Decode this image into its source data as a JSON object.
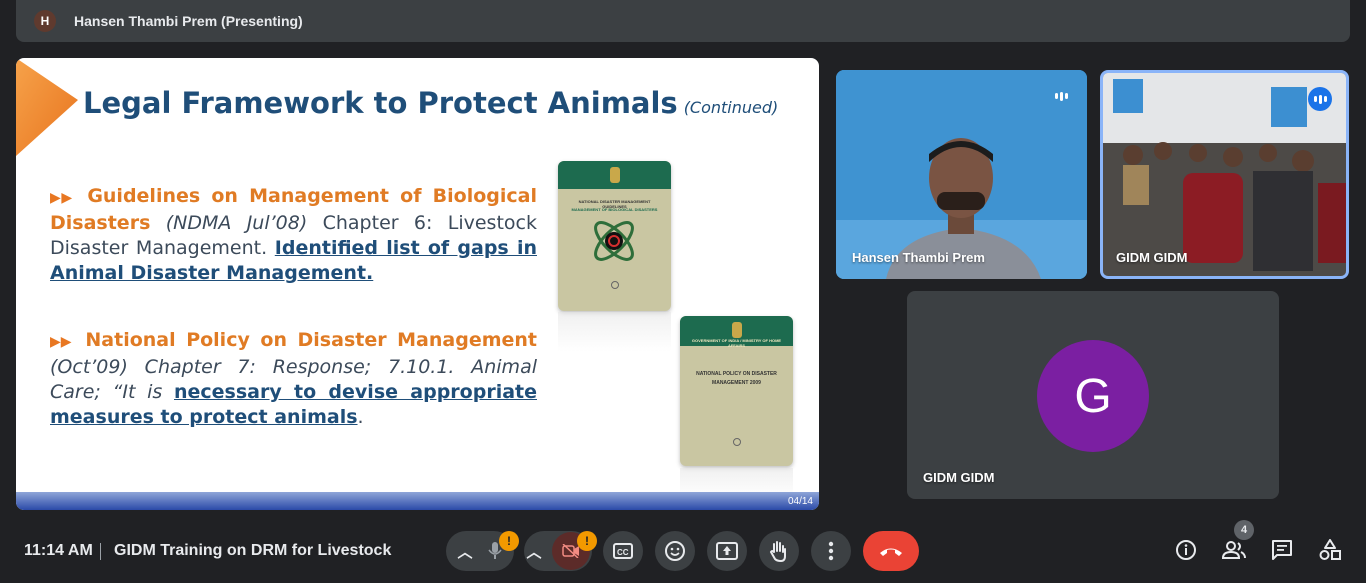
{
  "header": {
    "avatar_initial": "H",
    "presenter_label": "Hansen Thambi Prem (Presenting)"
  },
  "slide": {
    "title": "Legal Framework to Protect Animals",
    "title_suffix": "(Continued)",
    "bullet1": {
      "heading": "Guidelines on Management of Biological Disasters",
      "source": "(NDMA Jul’08)",
      "text": "Chapter 6: Livestock Disaster Management.",
      "link": "Identified list of gaps in Animal Disaster Management."
    },
    "bullet2": {
      "heading": "National Policy on Disaster Management",
      "source": "(Oct’09) Chapter 7: Response; 7.10.1. Animal Care;",
      "text": "“It is",
      "link": "necessary to devise appropriate measures to protect animals",
      "end": "."
    },
    "book1": {
      "title": "NATIONAL DISASTER MANAGEMENT GUIDELINES",
      "subtitle": "MANAGEMENT OF BIOLOGICAL DISASTERS"
    },
    "book2": {
      "header": "GOVERNMENT OF INDIA / MINISTRY OF HOME AFFAIRS",
      "title": "NATIONAL POLICY ON DISASTER MANAGEMENT 2009"
    },
    "page_indicator": "04/14"
  },
  "participants": [
    {
      "name": "Hansen Thambi Prem"
    },
    {
      "name": "GIDM GIDM"
    },
    {
      "name": "GIDM GIDM",
      "initial": "G"
    }
  ],
  "bottombar": {
    "time": "11:14 AM",
    "meeting_title": "GIDM Training on DRM for Livestock",
    "alert_mark": "!",
    "people_count": "4"
  },
  "colors": {
    "accent_blue": "#8ab4f8",
    "end_call": "#ea4335",
    "alert": "#f29900",
    "avatar_purple": "#7b1fa2",
    "slide_title": "#1f4e79",
    "slide_orange": "#e07b24"
  },
  "icons": [
    "mic-off-icon",
    "camera-off-icon",
    "captions-icon",
    "emoji-icon",
    "present-icon",
    "raise-hand-icon",
    "more-options-icon",
    "end-call-icon",
    "info-icon",
    "people-icon",
    "chat-icon",
    "activities-icon"
  ]
}
